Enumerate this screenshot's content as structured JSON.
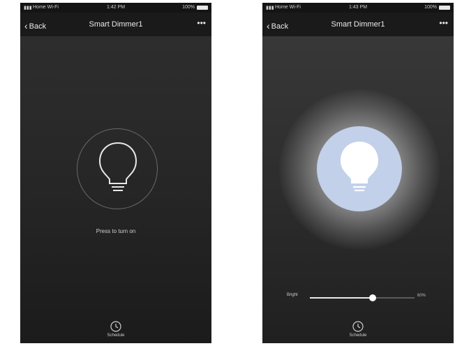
{
  "screens": [
    {
      "statusbar": {
        "carrier": "Home Wi-Fi",
        "time": "1:42 PM",
        "battery": "100%"
      },
      "navbar": {
        "back_label": "Back",
        "title": "Smart Dimmer1",
        "more": "•••"
      },
      "state": "off",
      "hint": "Press to turn on",
      "schedule_label": "Schedule"
    },
    {
      "statusbar": {
        "carrier": "Home Wi-Fi",
        "time": "1:43 PM",
        "battery": "100%"
      },
      "navbar": {
        "back_label": "Back",
        "title": "Smart Dimmer1",
        "more": "•••"
      },
      "state": "on",
      "brightness": {
        "label": "Bright",
        "value_percent": 60,
        "value_text": "60%"
      },
      "schedule_label": "Schedule"
    }
  ],
  "colors": {
    "bulb_on_fill": "#c3d0ea",
    "background_dark": "#2a2a2a",
    "navbar": "#1a1a1a"
  }
}
